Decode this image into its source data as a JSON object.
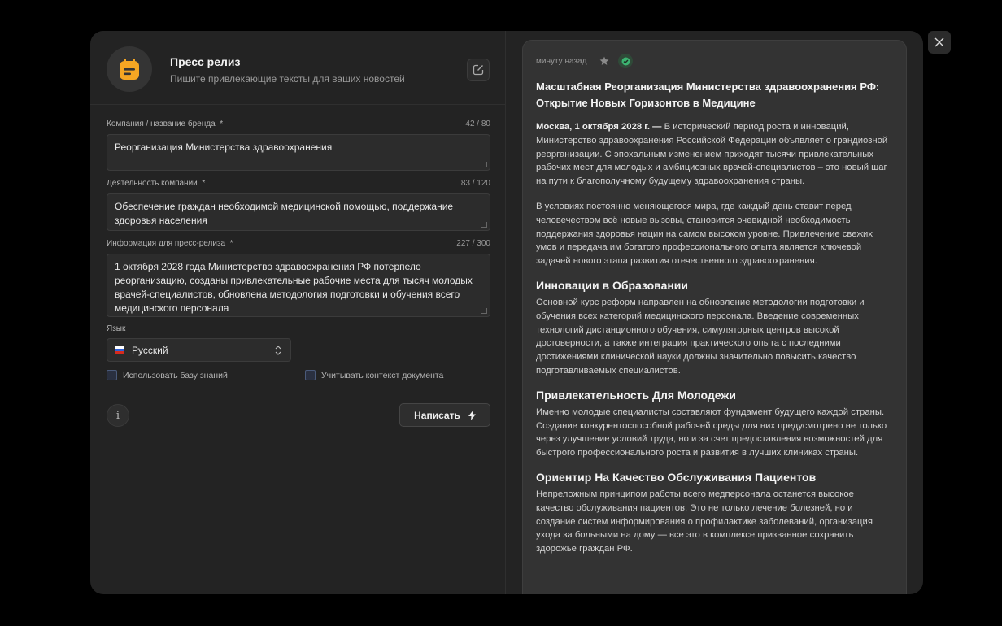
{
  "header": {
    "title": "Пресс релиз",
    "subtitle": "Пишите привлекающие тексты для ваших новостей"
  },
  "form": {
    "company": {
      "label": "Компания / название бренда",
      "required": "*",
      "count": "42 / 80",
      "value": "Реорганизация Министерства здравоохранения"
    },
    "activity": {
      "label": "Деятельность компании",
      "required": "*",
      "count": "83 / 120",
      "value": "Обеспечение граждан необходимой медицинской помощью, поддержание здоровья населения"
    },
    "info": {
      "label": "Информация для пресс-релиза",
      "required": "*",
      "count": "227 / 300",
      "value": "1 октября 2028 года Министерство здравоохранения РФ потерпело реорганизацию, созданы привлекательные рабочие места для тысяч молодых врачей-специалистов, обновлена методология подготовки и обучения всего медицинского персонала"
    },
    "language": {
      "label": "Язык",
      "value": "Русский"
    },
    "knowledge_base": "Использовать базу знаний",
    "doc_context": "Учитывать контекст документа",
    "info_icon": "i",
    "submit": "Написать"
  },
  "result": {
    "time": "минуту назад",
    "title": "Масштабная Реорганизация Министерства здравоохранения РФ: Открытие Новых Горизонтов в Медицине",
    "lead_bold": "Москва, 1 октября 2028 г. —",
    "lead": " В исторический период роста и инноваций, Министерство здравоохранения Российской Федерации объявляет о грандиозной реорганизации. С эпохальным изменением приходят тысячи привлекательных рабочих мест для молодых и амбициозных врачей-специалистов – это новый шаг на пути к благополучному будущему здравоохранения страны.",
    "p2": "В условиях постоянно меняющегося мира, где каждый день ставит перед человечеством всё новые вызовы, становится очевидной необходимость поддержания здоровья нации на самом высоком уровне. Привлечение свежих умов и передача им богатого профессионального опыта является ключевой задачей нового этапа развития отечественного здравоохранения.",
    "h1": "Инновации в Образовании",
    "p3": "Основной курс реформ направлен на обновление методологии подготовки и обучения всех категорий медицинского персонала. Введение современных технологий дистанционного обучения, симуляторных центров высокой достоверности, а также интеграция практического опыта с последними достижениями клинической науки должны значительно повысить качество подготавливаемых специалистов.",
    "h2": "Привлекательность Для Молодежи",
    "p4": "Именно молодые специалисты составляют фундамент будущего каждой страны. Создание конкурентоспособной рабочей среды для них предусмотрено не только через улучшение условий труда, но и за счет предоставления возможностей для быстрого профессионального роста и развития в лучших клиниках страны.",
    "h3": "Ориентир На Качество Обслуживания Пациентов",
    "p5": "Непреложным принципом работы всего медперсонала останется высокое качество обслуживания пациентов. Это не только лечение болезней, но и создание систем информирования о профилактике заболеваний, организация ухода за больными на дому — все это в комплексе призванное сохранить здорожье граждан РФ."
  },
  "colors": {
    "accent": "#f5a623",
    "check": "#3cb371"
  }
}
